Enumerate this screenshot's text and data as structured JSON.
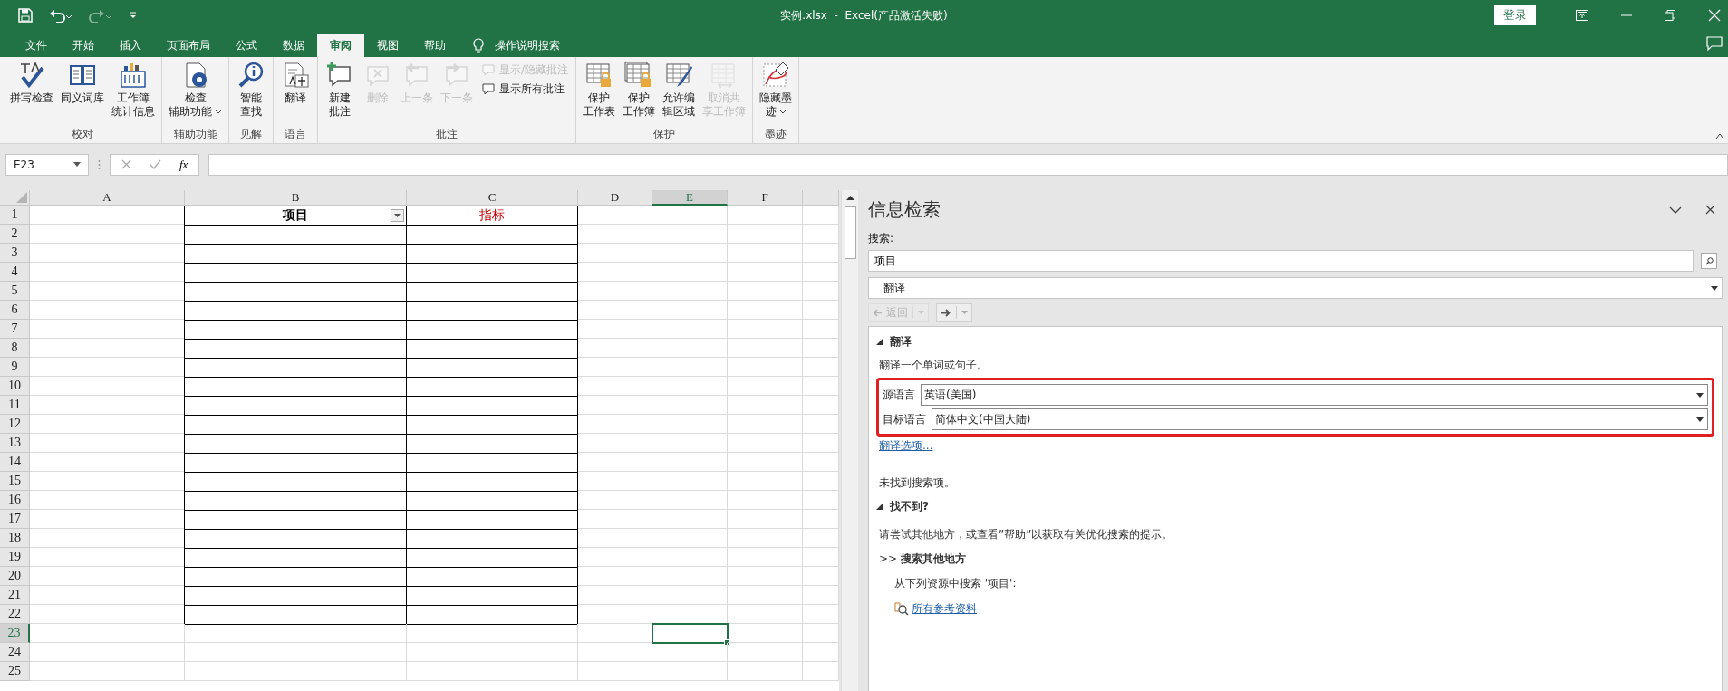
{
  "title_bar": {
    "quick_access": [
      {
        "disabled": false
      },
      {
        "disabled": false
      },
      {
        "disabled": true
      },
      {
        "disabled": false
      }
    ],
    "title": "实例.xlsx  -  Excel(产品激活失败)",
    "sign_in": "登录"
  },
  "tabs": [
    {
      "label": "文件",
      "selected": false
    },
    {
      "label": "开始",
      "selected": false
    },
    {
      "label": "插入",
      "selected": false
    },
    {
      "label": "页面布局",
      "selected": false
    },
    {
      "label": "公式",
      "selected": false
    },
    {
      "label": "数据",
      "selected": false
    },
    {
      "label": "审阅",
      "selected": true
    },
    {
      "label": "视图",
      "selected": false
    },
    {
      "label": "帮助",
      "selected": false
    }
  ],
  "tell_me": "操作说明搜索",
  "ribbon": {
    "groups": [
      {
        "label": "校对",
        "buttons": [
          {
            "lines": [
              "拼写检查"
            ],
            "kind": "large",
            "disabled": false,
            "menu": false
          },
          {
            "lines": [
              "同义词库"
            ],
            "kind": "large",
            "disabled": false,
            "menu": false
          },
          {
            "lines": [
              "工作簿",
              "统计信息"
            ],
            "kind": "large",
            "disabled": false,
            "menu": false
          }
        ]
      },
      {
        "label": "辅助功能",
        "buttons": [
          {
            "lines": [
              "检查",
              "辅助功能"
            ],
            "kind": "large",
            "disabled": false,
            "menu": true
          }
        ]
      },
      {
        "label": "见解",
        "buttons": [
          {
            "lines": [
              "智能",
              "查找"
            ],
            "kind": "large",
            "disabled": false,
            "menu": false
          }
        ]
      },
      {
        "label": "语言",
        "buttons": [
          {
            "lines": [
              "翻译"
            ],
            "kind": "large",
            "disabled": false,
            "menu": false
          }
        ]
      },
      {
        "label": "批注",
        "buttons": [
          {
            "lines": [
              "新建",
              "批注"
            ],
            "kind": "large",
            "disabled": false,
            "menu": false
          },
          {
            "lines": [
              "删除"
            ],
            "kind": "large",
            "disabled": true,
            "menu": false
          },
          {
            "lines": [
              "上一条"
            ],
            "kind": "large",
            "disabled": true,
            "menu": false
          },
          {
            "lines": [
              "下一条"
            ],
            "kind": "large",
            "disabled": true,
            "menu": false
          },
          {
            "lines": [
              "显示/隐藏批注"
            ],
            "kind": "small",
            "disabled": true,
            "menu": false
          },
          {
            "lines": [
              "显示所有批注"
            ],
            "kind": "small",
            "disabled": false,
            "menu": false
          }
        ]
      },
      {
        "label": "保护",
        "buttons": [
          {
            "lines": [
              "保护",
              "工作表"
            ],
            "kind": "large",
            "disabled": false,
            "menu": false
          },
          {
            "lines": [
              "保护",
              "工作簿"
            ],
            "kind": "large",
            "disabled": false,
            "menu": false
          },
          {
            "lines": [
              "允许编",
              "辑区域"
            ],
            "kind": "large",
            "disabled": false,
            "menu": false
          },
          {
            "lines": [
              "取消共",
              "享工作簿"
            ],
            "kind": "large",
            "disabled": true,
            "menu": false
          }
        ]
      },
      {
        "label": "墨迹",
        "buttons": [
          {
            "lines": [
              "隐藏墨",
              "迹"
            ],
            "kind": "large",
            "disabled": false,
            "menu": true
          }
        ]
      }
    ]
  },
  "formula_bar": {
    "name_box": "E23",
    "function_label": "fx"
  },
  "sheet": {
    "columns": [
      {
        "label": "A",
        "selected": false,
        "in_table": false
      },
      {
        "label": "B",
        "selected": false,
        "in_table": true
      },
      {
        "label": "C",
        "selected": false,
        "in_table": true
      },
      {
        "label": "D",
        "selected": false,
        "in_table": false
      },
      {
        "label": "E",
        "selected": true,
        "in_table": false
      },
      {
        "label": "F",
        "selected": false,
        "in_table": false
      }
    ],
    "table_header": [
      {
        "text": "项目",
        "bold": true,
        "filter": true,
        "color": "#000000"
      },
      {
        "text": "指标",
        "bold": false,
        "filter": false,
        "color": "#c00000"
      }
    ],
    "rows": [
      {
        "label": "1",
        "selected": false,
        "bordered": true
      },
      {
        "label": "2",
        "selected": false,
        "bordered": true
      },
      {
        "label": "3",
        "selected": false,
        "bordered": true
      },
      {
        "label": "4",
        "selected": false,
        "bordered": true
      },
      {
        "label": "5",
        "selected": false,
        "bordered": true
      },
      {
        "label": "6",
        "selected": false,
        "bordered": true
      },
      {
        "label": "7",
        "selected": false,
        "bordered": true
      },
      {
        "label": "8",
        "selected": false,
        "bordered": true
      },
      {
        "label": "9",
        "selected": false,
        "bordered": true
      },
      {
        "label": "10",
        "selected": false,
        "bordered": true
      },
      {
        "label": "11",
        "selected": false,
        "bordered": true
      },
      {
        "label": "12",
        "selected": false,
        "bordered": true
      },
      {
        "label": "13",
        "selected": false,
        "bordered": true
      },
      {
        "label": "14",
        "selected": false,
        "bordered": true
      },
      {
        "label": "15",
        "selected": false,
        "bordered": true
      },
      {
        "label": "16",
        "selected": false,
        "bordered": true
      },
      {
        "label": "17",
        "selected": false,
        "bordered": true
      },
      {
        "label": "18",
        "selected": false,
        "bordered": true
      },
      {
        "label": "19",
        "selected": false,
        "bordered": true
      },
      {
        "label": "20",
        "selected": false,
        "bordered": true
      },
      {
        "label": "21",
        "selected": false,
        "bordered": true
      },
      {
        "label": "22",
        "selected": false,
        "bordered": true
      },
      {
        "label": "23",
        "selected": true,
        "bordered": false
      },
      {
        "label": "24",
        "selected": false,
        "bordered": false
      },
      {
        "label": "25",
        "selected": false,
        "bordered": false
      }
    ]
  },
  "research_pane": {
    "title": "信息检索",
    "search_label": "搜索:",
    "search_value": "项目",
    "source": "翻译",
    "back": {
      "label": "返回",
      "disabled": true
    },
    "forward": {
      "disabled": false
    },
    "section": {
      "title": "翻译",
      "expanded": true
    },
    "description": "翻译一个单词或句子。",
    "highlighted": true,
    "languages": [
      {
        "label": "源语言",
        "value": "英语(美国)"
      },
      {
        "label": "目标语言",
        "value": "简体中文(中国大陆)"
      }
    ],
    "options_link": "翻译选项...",
    "not_found": "未找到搜索项。",
    "help_section": {
      "title": "找不到?",
      "expanded": true
    },
    "hint": "请尝试其他地方，或查看”帮助”以获取有关优化搜索的提示。",
    "more_heading": ">> **搜索其他地方**",
    "sources_text": "从下列资源中搜索 '项目':",
    "sources_link": "所有参考资料"
  }
}
